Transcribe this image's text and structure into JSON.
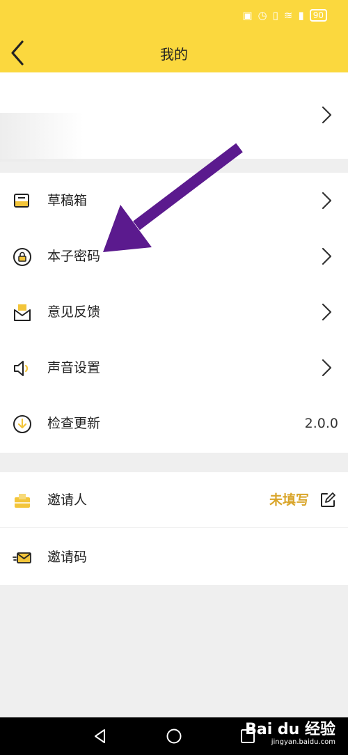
{
  "status": {
    "battery": "90"
  },
  "header": {
    "title": "我的"
  },
  "menu1": [
    {
      "label": "草稿箱",
      "icon": "drafts-tray-icon"
    },
    {
      "label": "本子密码",
      "icon": "lock-icon"
    },
    {
      "label": "意见反馈",
      "icon": "feedback-envelope-icon"
    },
    {
      "label": "声音设置",
      "icon": "speaker-icon"
    },
    {
      "label": "检查更新",
      "icon": "download-circle-icon",
      "value": "2.0.0"
    }
  ],
  "menu2": [
    {
      "label": "邀请人",
      "icon": "inviter-box-icon",
      "value": "未填写"
    },
    {
      "label": "邀请码",
      "icon": "invite-code-envelope-icon"
    }
  ],
  "watermark": {
    "logo": "Bai du 经验",
    "url": "jingyan.baidu.com"
  },
  "colors": {
    "header": "#fbd83e",
    "accent": "#d9a52a",
    "arrow": "#5b1a8e"
  }
}
